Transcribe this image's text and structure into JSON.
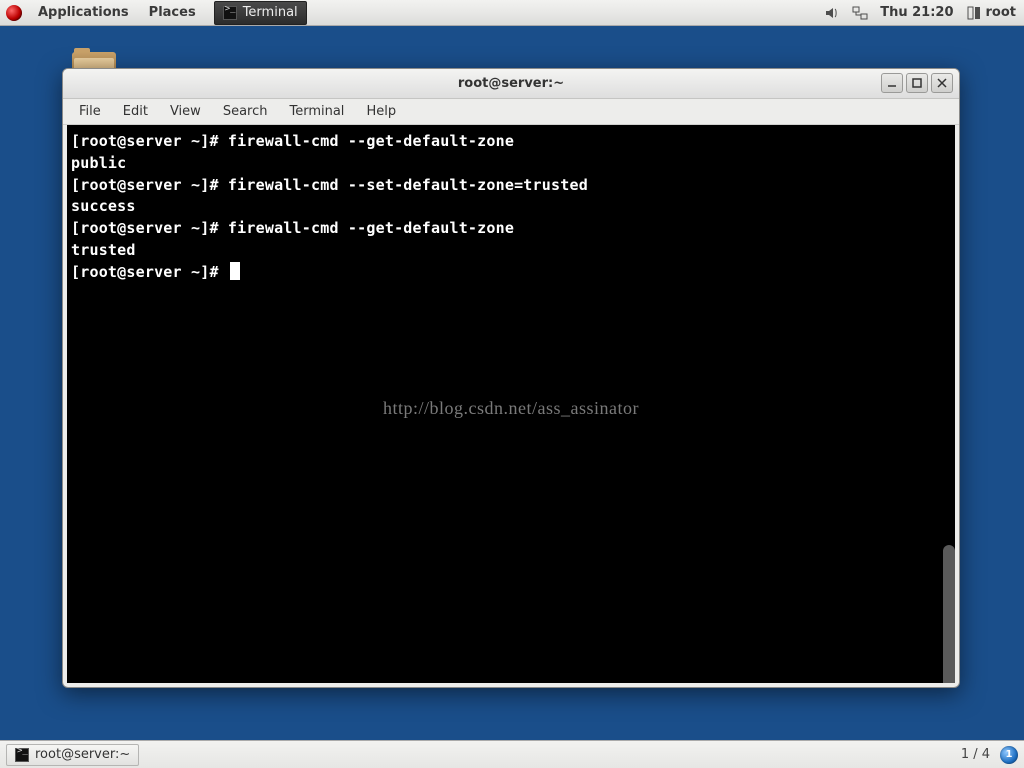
{
  "top_panel": {
    "applications": "Applications",
    "places": "Places",
    "task_button": "Terminal",
    "clock": "Thu 21:20",
    "user": "root"
  },
  "window": {
    "title": "root@server:~",
    "menubar": {
      "file": "File",
      "edit": "Edit",
      "view": "View",
      "search": "Search",
      "terminal": "Terminal",
      "help": "Help"
    }
  },
  "terminal": {
    "lines": [
      "[root@server ~]# firewall-cmd --get-default-zone",
      "public",
      "[root@server ~]# firewall-cmd --set-default-zone=trusted",
      "success",
      "[root@server ~]# firewall-cmd --get-default-zone",
      "trusted",
      "[root@server ~]# "
    ],
    "watermark": "http://blog.csdn.net/ass_assinator"
  },
  "bottom_panel": {
    "task_button": "root@server:~",
    "workspace_label": "1 / 4",
    "workspace_badge": "1"
  }
}
